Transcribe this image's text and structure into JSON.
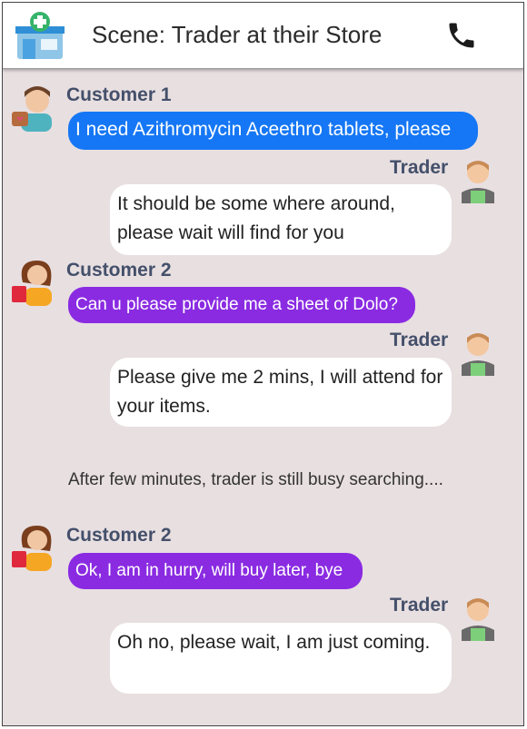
{
  "header": {
    "title": "Scene: Trader at their Store",
    "store_icon": "pharmacy-store-icon",
    "phone_icon": "phone-icon"
  },
  "colors": {
    "customer1_bubble": "#1577f5",
    "customer2_bubble": "#8a2be2",
    "trader_bubble": "#ffffff",
    "name_text": "#44506a",
    "background": "#e8dfe1"
  },
  "messages": [
    {
      "speaker": "Customer 1",
      "text": "I need Azithromycin Aceethro tablets, please"
    },
    {
      "speaker": "Trader",
      "text": "It should be some where around, please wait will find for you"
    },
    {
      "speaker": "Customer 2",
      "text": "Can u please provide me a sheet of Dolo?"
    },
    {
      "speaker": "Trader",
      "text": "Please give me 2 mins, I will attend for your items."
    },
    {
      "speaker": "Customer 2",
      "text": "Ok, I am in hurry, will buy later, bye"
    },
    {
      "speaker": "Trader",
      "text": "Oh no, please wait, I am just coming."
    }
  ],
  "narration": "After few minutes, trader is still busy searching...."
}
